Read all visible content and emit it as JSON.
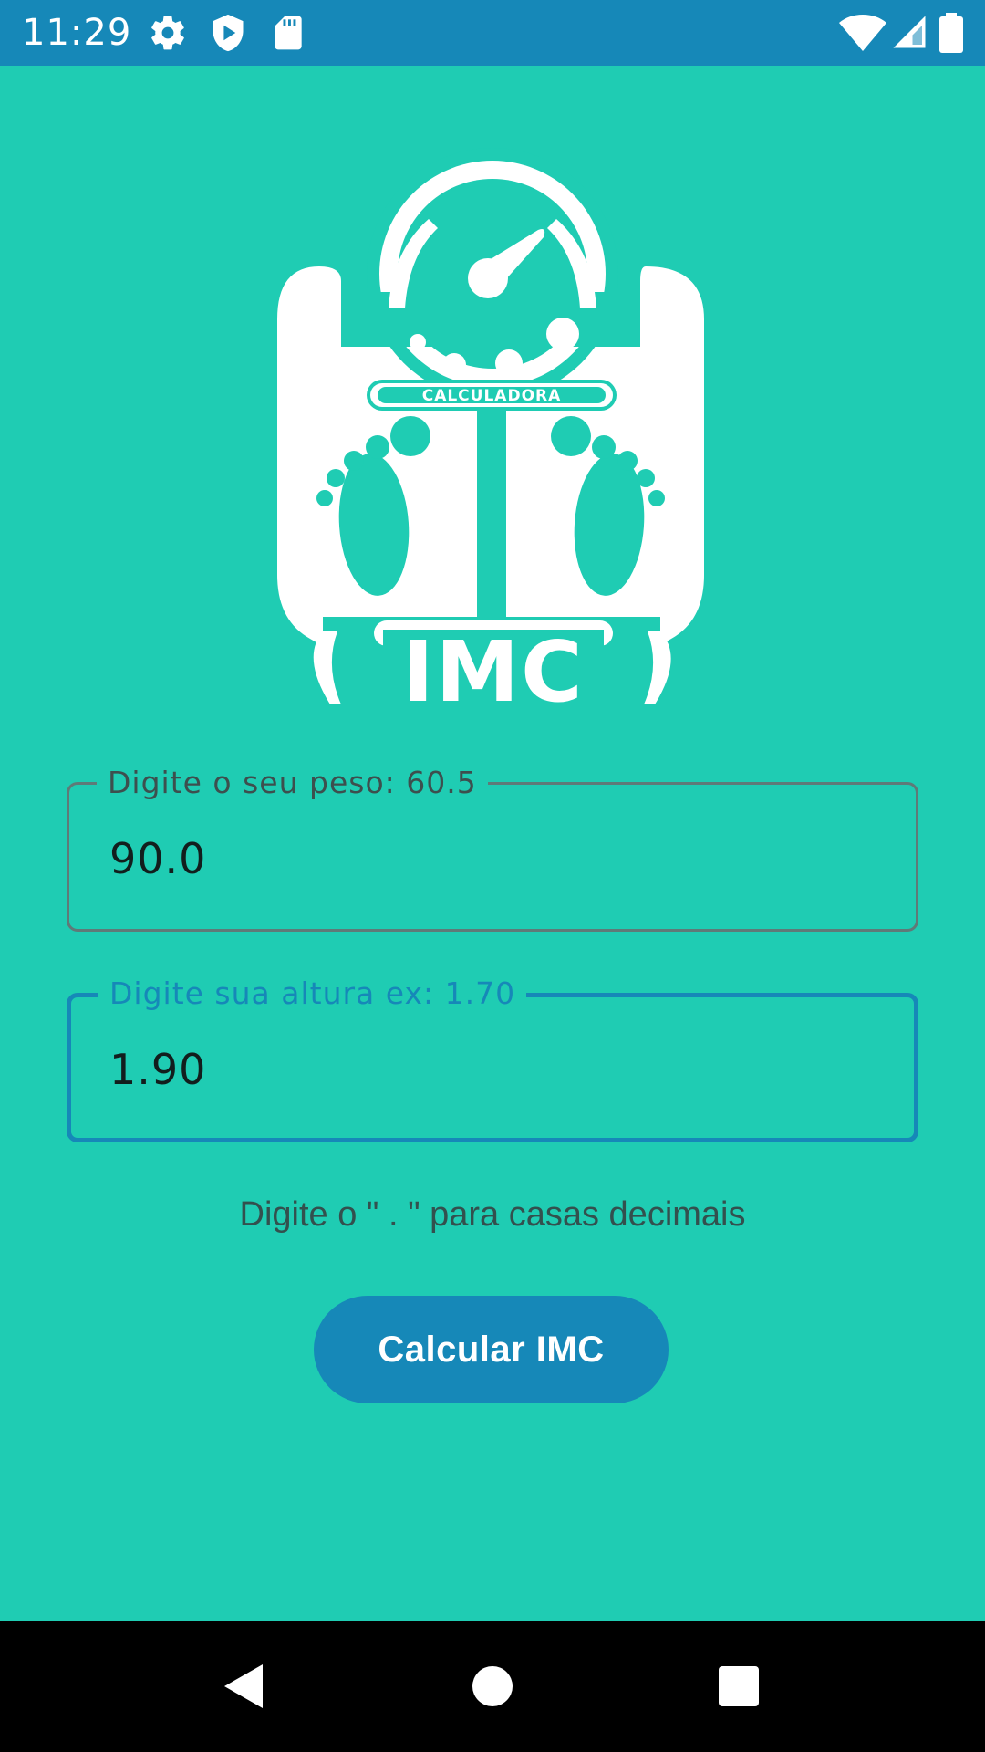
{
  "status_bar": {
    "time": "11:29",
    "left_icons": [
      "gear-icon",
      "shield-play-icon",
      "sd-card-icon"
    ],
    "right_icons": [
      "wifi-icon",
      "cellular-signal-icon",
      "battery-icon"
    ],
    "color": "#1688b8"
  },
  "logo": {
    "top_text": "CALCULADORA",
    "main_text": "IMC",
    "icon": "bathroom-scale-icon"
  },
  "form": {
    "weight": {
      "label": "Digite o seu peso: 60.5",
      "value": "90.0"
    },
    "height": {
      "label": "Digite sua altura ex: 1.70",
      "value": "1.90"
    },
    "hint": "Digite o \" . \" para casas decimais",
    "button_label": "Calcular IMC"
  },
  "nav_bar": {
    "buttons": [
      "back-icon",
      "home-icon",
      "recents-icon"
    ]
  },
  "colors": {
    "background": "#1fccb3",
    "accent": "#1688b8",
    "text": "#33504e"
  }
}
